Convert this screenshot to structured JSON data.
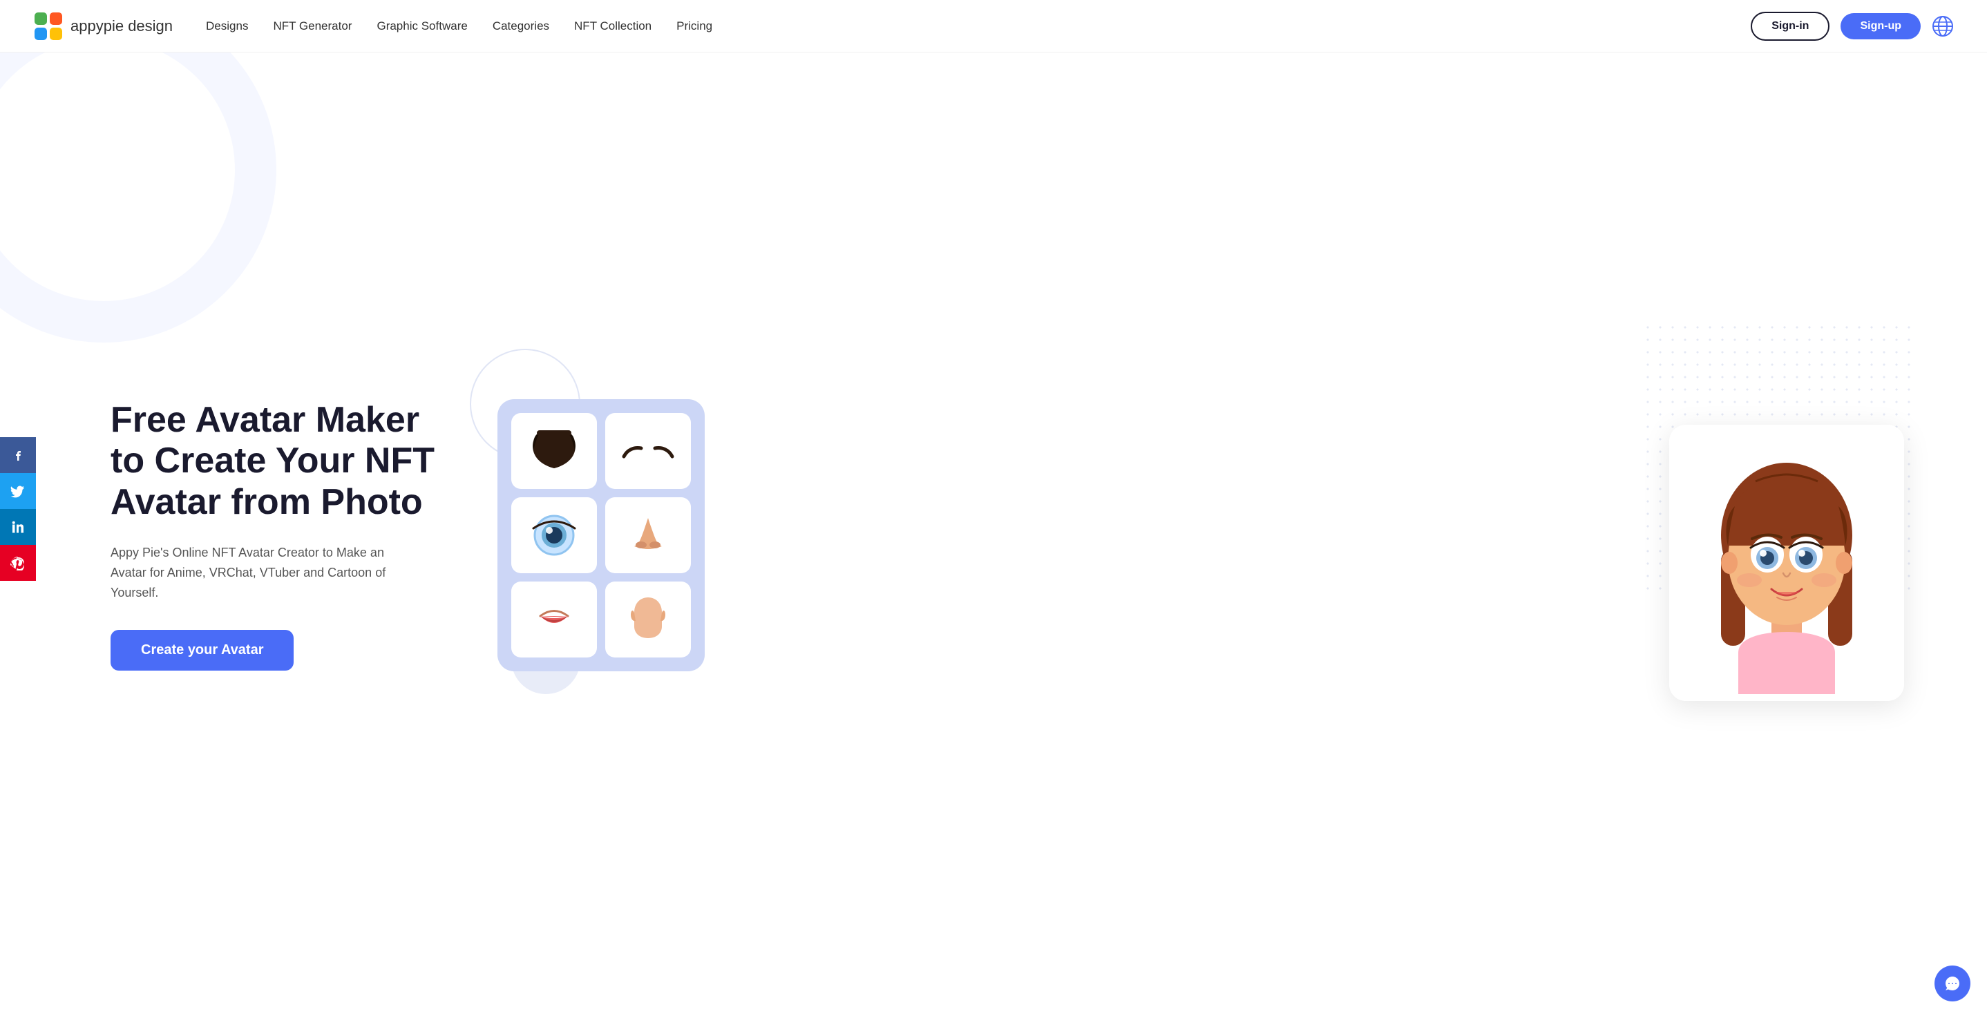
{
  "navbar": {
    "logo_text": "appypie",
    "logo_subtext": " design",
    "links": [
      {
        "label": "Designs",
        "id": "designs"
      },
      {
        "label": "NFT Generator",
        "id": "nft-generator"
      },
      {
        "label": "Graphic Software",
        "id": "graphic-software"
      },
      {
        "label": "Categories",
        "id": "categories"
      },
      {
        "label": "NFT Collection",
        "id": "nft-collection"
      },
      {
        "label": "Pricing",
        "id": "pricing"
      }
    ],
    "signin_label": "Sign-in",
    "signup_label": "Sign-up"
  },
  "social": [
    {
      "platform": "facebook",
      "icon": "f",
      "label": "Facebook"
    },
    {
      "platform": "twitter",
      "icon": "t",
      "label": "Twitter"
    },
    {
      "platform": "linkedin",
      "icon": "in",
      "label": "LinkedIn"
    },
    {
      "platform": "pinterest",
      "icon": "p",
      "label": "Pinterest"
    }
  ],
  "hero": {
    "title": "Free Avatar Maker to Create Your NFT Avatar from Photo",
    "subtitle": "Appy Pie's Online NFT Avatar Creator to Make an Avatar for Anime, VRChat, VTuber and Cartoon of Yourself.",
    "cta_label": "Create your Avatar"
  },
  "chat": {
    "tooltip": "Chat support"
  }
}
